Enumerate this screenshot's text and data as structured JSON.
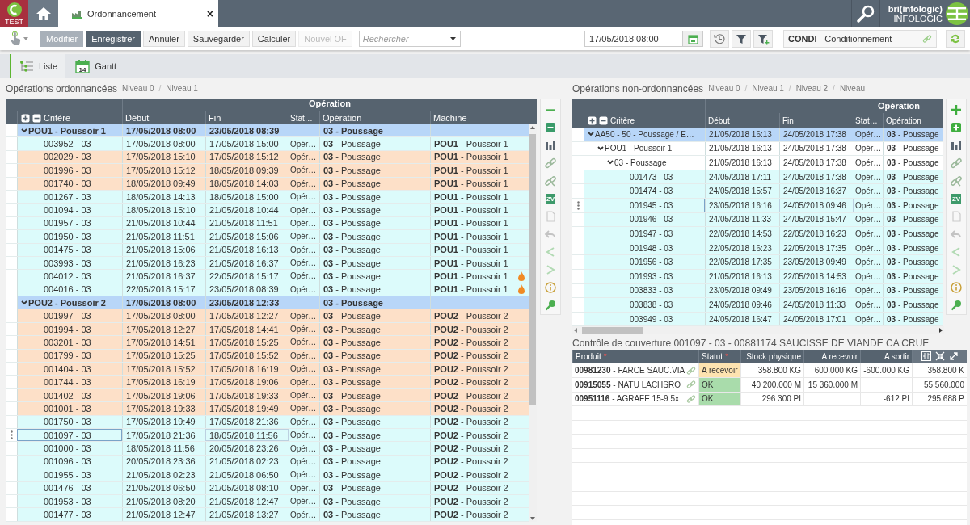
{
  "app": {
    "env_label": "TEST"
  },
  "tabs": [
    {
      "label": "Ordonnancement",
      "selected": true,
      "close": "×"
    }
  ],
  "user": {
    "name": "bri(infologic)",
    "company": "INFOLOGIC"
  },
  "toolbar": {
    "buttons": [
      {
        "label": "Modifier",
        "kind": "muted",
        "disabled": false
      },
      {
        "label": "Enregistrer",
        "kind": "primary",
        "disabled": false
      },
      {
        "label": "Annuler",
        "kind": "plain",
        "disabled": false
      },
      {
        "label": "Sauvegarder",
        "kind": "plain",
        "disabled": false
      },
      {
        "label": "Calculer",
        "kind": "plain",
        "disabled": false
      },
      {
        "label": "Nouvel OF",
        "kind": "plain",
        "disabled": true
      }
    ],
    "search": {
      "placeholder": "Rechercher"
    },
    "date": {
      "value": "17/05/2018 08:00"
    },
    "context": {
      "value": "**CONDI** - Conditionnement"
    }
  },
  "views": [
    {
      "label": "Liste",
      "kind": "list",
      "selected": true
    },
    {
      "label": "Gantt",
      "kind": "gantt",
      "selected": false,
      "icon_text": "14"
    }
  ],
  "left_panel": {
    "title": "Opérations ordonnancées",
    "breadcrumbs": [
      {
        "label": "Niveau 0",
        "separator": "/"
      },
      {
        "label": "Niveau 1"
      }
    ],
    "table": {
      "group_header": "Opération",
      "columns": [
        "Critère",
        "Début",
        "Fin",
        "Stat…",
        "Opération",
        "Machine"
      ],
      "rows": [
        {
          "kind": "group",
          "expanded": true,
          "selected": false,
          "color": "#b8d6f8",
          "criterion": "POU1 - Poussoir 1",
          "start": "17/05/2018 08:00",
          "end": "23/05/2018 08:39",
          "operation": "03 - Poussage",
          "children": [
            {
              "kind": "item",
              "selected": false,
              "alert": false,
              "color": "#dcfbfb",
              "criterion": "003952 - 03",
              "start": "17/05/2018 08:00",
              "end": "17/05/2018 15:00",
              "status": "Opér…",
              "operation": "**03** - Poussage",
              "machine": "**POU1** - Poussoir 1"
            },
            {
              "kind": "item",
              "selected": false,
              "alert": false,
              "color": "#fde0c8",
              "criterion": "002029 - 03",
              "start": "17/05/2018 15:10",
              "end": "17/05/2018 15:12",
              "status": "Opér…",
              "operation": "**03** - Poussage",
              "machine": "**POU1** - Poussoir 1"
            },
            {
              "kind": "item",
              "selected": false,
              "alert": false,
              "color": "#fde0c8",
              "criterion": "001996 - 03",
              "start": "17/05/2018 15:12",
              "end": "18/05/2018 09:39",
              "status": "Opér…",
              "operation": "**03** - Poussage",
              "machine": "**POU1** - Poussoir 1"
            },
            {
              "kind": "item",
              "selected": false,
              "alert": false,
              "color": "#fde0c8",
              "criterion": "001740 - 03",
              "start": "18/05/2018 09:49",
              "end": "18/05/2018 14:03",
              "status": "Opér…",
              "operation": "**03** - Poussage",
              "machine": "**POU1** - Poussoir 1"
            },
            {
              "kind": "item",
              "selected": false,
              "alert": false,
              "color": "#dcfbfb",
              "criterion": "001267 - 03",
              "start": "18/05/2018 14:13",
              "end": "18/05/2018 15:00",
              "status": "Opér…",
              "operation": "**03** - Poussage",
              "machine": "**POU1** - Poussoir 1"
            },
            {
              "kind": "item",
              "selected": false,
              "alert": false,
              "color": "#dcfbfb",
              "criterion": "001094 - 03",
              "start": "18/05/2018 15:10",
              "end": "21/05/2018 10:44",
              "status": "Opér…",
              "operation": "**03** - Poussage",
              "machine": "**POU1** - Poussoir 1"
            },
            {
              "kind": "item",
              "selected": false,
              "alert": false,
              "color": "#dcfbfb",
              "criterion": "001957 - 03",
              "start": "21/05/2018 10:44",
              "end": "21/05/2018 11:51",
              "status": "Opér…",
              "operation": "**03** - Poussage",
              "machine": "**POU1** - Poussoir 1"
            },
            {
              "kind": "item",
              "selected": false,
              "alert": false,
              "color": "#dcfbfb",
              "criterion": "001950 - 03",
              "start": "21/05/2018 11:51",
              "end": "21/05/2018 15:06",
              "status": "Opér…",
              "operation": "**03** - Poussage",
              "machine": "**POU1** - Poussoir 1"
            },
            {
              "kind": "item",
              "selected": false,
              "alert": false,
              "color": "#dcfbfb",
              "criterion": "001475 - 03",
              "start": "21/05/2018 15:06",
              "end": "21/05/2018 16:13",
              "status": "Opér…",
              "operation": "**03** - Poussage",
              "machine": "**POU1** - Poussoir 1"
            },
            {
              "kind": "item",
              "selected": false,
              "alert": false,
              "color": "#dcfbfb",
              "criterion": "003993 - 03",
              "start": "21/05/2018 16:23",
              "end": "21/05/2018 16:37",
              "status": "Opér…",
              "operation": "**03** - Poussage",
              "machine": "**POU1** - Poussoir 1"
            },
            {
              "kind": "item",
              "selected": false,
              "alert": true,
              "color": "#dcfbfb",
              "criterion": "004012 - 03",
              "start": "21/05/2018 16:37",
              "end": "22/05/2018 15:17",
              "status": "Opér…",
              "operation": "**03** - Poussage",
              "machine": "**POU1** - Poussoir 1"
            },
            {
              "kind": "item",
              "selected": false,
              "alert": true,
              "color": "#dcfbfb",
              "criterion": "004016 - 03",
              "start": "22/05/2018 15:17",
              "end": "23/05/2018 08:39",
              "status": "Opér…",
              "operation": "**03** - Poussage",
              "machine": "**POU1** - Poussoir 1"
            }
          ]
        },
        {
          "kind": "group",
          "expanded": true,
          "selected": false,
          "color": "#b8d6f8",
          "criterion": "POU2 - Poussoir 2",
          "start": "17/05/2018 08:00",
          "end": "23/05/2018 12:33",
          "operation": "03 - Poussage",
          "children": [
            {
              "kind": "item",
              "selected": false,
              "alert": false,
              "color": "#fde0c8",
              "criterion": "001997 - 03",
              "start": "17/05/2018 08:00",
              "end": "17/05/2018 12:27",
              "status": "Opér…",
              "operation": "**03** - Poussage",
              "machine": "**POU2** - Poussoir 2"
            },
            {
              "kind": "item",
              "selected": false,
              "alert": false,
              "color": "#fde0c8",
              "criterion": "001994 - 03",
              "start": "17/05/2018 12:27",
              "end": "17/05/2018 14:41",
              "status": "Opér…",
              "operation": "**03** - Poussage",
              "machine": "**POU2** - Poussoir 2"
            },
            {
              "kind": "item",
              "selected": false,
              "alert": false,
              "color": "#fde0c8",
              "criterion": "003201 - 03",
              "start": "17/05/2018 14:51",
              "end": "17/05/2018 15:25",
              "status": "Opér…",
              "operation": "**03** - Poussage",
              "machine": "**POU2** - Poussoir 2"
            },
            {
              "kind": "item",
              "selected": false,
              "alert": false,
              "color": "#fde0c8",
              "criterion": "001799 - 03",
              "start": "17/05/2018 15:25",
              "end": "17/05/2018 15:52",
              "status": "Opér…",
              "operation": "**03** - Poussage",
              "machine": "**POU2** - Poussoir 2"
            },
            {
              "kind": "item",
              "selected": false,
              "alert": false,
              "color": "#fde0c8",
              "criterion": "001404 - 03",
              "start": "17/05/2018 15:52",
              "end": "17/05/2018 16:19",
              "status": "Opér…",
              "operation": "**03** - Poussage",
              "machine": "**POU2** - Poussoir 2"
            },
            {
              "kind": "item",
              "selected": false,
              "alert": false,
              "color": "#fde0c8",
              "criterion": "001744 - 03",
              "start": "17/05/2018 16:19",
              "end": "17/05/2018 19:06",
              "status": "Opér…",
              "operation": "**03** - Poussage",
              "machine": "**POU2** - Poussoir 2"
            },
            {
              "kind": "item",
              "selected": false,
              "alert": false,
              "color": "#fde0c8",
              "criterion": "001402 - 03",
              "start": "17/05/2018 19:06",
              "end": "17/05/2018 19:33",
              "status": "Opér…",
              "operation": "**03** - Poussage",
              "machine": "**POU2** - Poussoir 2"
            },
            {
              "kind": "item",
              "selected": false,
              "alert": false,
              "color": "#fde0c8",
              "criterion": "001001 - 03",
              "start": "17/05/2018 19:33",
              "end": "17/05/2018 19:49",
              "status": "Opér…",
              "operation": "**03** - Poussage",
              "machine": "**POU2** - Poussoir 2"
            },
            {
              "kind": "item",
              "selected": false,
              "alert": false,
              "color": "#dcfbfb",
              "criterion": "001750 - 03",
              "start": "17/05/2018 19:49",
              "end": "17/05/2018 21:36",
              "status": "Opér…",
              "operation": "**03** - Poussage",
              "machine": "**POU2** - Poussoir 2"
            },
            {
              "kind": "item",
              "selected": true,
              "alert": false,
              "color": "#dcfbfb",
              "criterion": "001097 - 03",
              "start": "17/05/2018 21:36",
              "end": "18/05/2018 11:56",
              "status": "Opér…",
              "operation": "**03** - Poussage",
              "machine": "**POU2** - Poussoir 2"
            },
            {
              "kind": "item",
              "selected": false,
              "alert": false,
              "color": "#dcfbfb",
              "criterion": "001000 - 03",
              "start": "18/05/2018 11:56",
              "end": "20/05/2018 23:26",
              "status": "Opér…",
              "operation": "**03** - Poussage",
              "machine": "**POU2** - Poussoir 2"
            },
            {
              "kind": "item",
              "selected": false,
              "alert": false,
              "color": "#dcfbfb",
              "criterion": "001096 - 03",
              "start": "20/05/2018 23:36",
              "end": "21/05/2018 02:23",
              "status": "Opér…",
              "operation": "**03** - Poussage",
              "machine": "**POU2** - Poussoir 2"
            },
            {
              "kind": "item",
              "selected": false,
              "alert": false,
              "color": "#dcfbfb",
              "criterion": "001955 - 03",
              "start": "21/05/2018 02:23",
              "end": "21/05/2018 06:50",
              "status": "Opér…",
              "operation": "**03** - Poussage",
              "machine": "**POU2** - Poussoir 2"
            },
            {
              "kind": "item",
              "selected": false,
              "alert": false,
              "color": "#dcfbfb",
              "criterion": "001476 - 03",
              "start": "21/05/2018 06:50",
              "end": "21/05/2018 08:10",
              "status": "Opér…",
              "operation": "**03** - Poussage",
              "machine": "**POU2** - Poussoir 2"
            },
            {
              "kind": "item",
              "selected": false,
              "alert": false,
              "color": "#dcfbfb",
              "criterion": "001953 - 03",
              "start": "21/05/2018 08:20",
              "end": "21/05/2018 12:47",
              "status": "Opér…",
              "operation": "**03** - Poussage",
              "machine": "**POU2** - Poussoir 2"
            },
            {
              "kind": "item",
              "selected": false,
              "alert": false,
              "color": "#dcfbfb",
              "criterion": "001477 - 03",
              "start": "21/05/2018 12:47",
              "end": "21/05/2018 13:27",
              "status": "Opér…",
              "operation": "**03** - Poussage",
              "machine": "**POU2** - Poussoir 2"
            }
          ]
        }
      ]
    },
    "tools": [
      {
        "kind": "collapse",
        "disabled": false
      },
      {
        "kind": "panel",
        "disabled": false
      },
      {
        "kind": "chart",
        "disabled": false
      },
      {
        "kind": "link",
        "disabled": false
      },
      {
        "kind": "unlink",
        "disabled": false
      },
      {
        "kind": "zv",
        "label": "ZV",
        "disabled": false
      },
      {
        "kind": "document",
        "disabled": true
      },
      {
        "kind": "undo",
        "disabled": true
      },
      {
        "kind": "prev",
        "disabled": true
      },
      {
        "kind": "next",
        "disabled": true
      },
      {
        "kind": "info",
        "disabled": false
      },
      {
        "kind": "zoom",
        "disabled": false
      }
    ]
  },
  "right_panel": {
    "title": "Opérations non-ordonnancées",
    "breadcrumbs": [
      {
        "label": "Niveau 0",
        "separator": "/"
      },
      {
        "label": "Niveau 1",
        "separator": "/"
      },
      {
        "label": "Niveau 2",
        "separator": "/"
      },
      {
        "label": "Niveau"
      }
    ],
    "table": {
      "group_header": "Opération",
      "columns": [
        "Critère",
        "Début",
        "Fin",
        "Stat…",
        "Opération"
      ],
      "rows": [
        {
          "kind": "node",
          "expanded": true,
          "selected": false,
          "color": "#b8d6f8",
          "criterion": "AA50 - 50 - Poussage / E…",
          "start": "21/05/2018 16:13",
          "end": "24/05/2018 17:38",
          "status": "Opér…",
          "operation": "**03** - Poussage",
          "children": [
            {
              "kind": "node",
              "expanded": true,
              "selected": false,
              "color": "#ffffff",
              "criterion": "POU1 - Poussoir 1",
              "start": "21/05/2018 16:13",
              "end": "24/05/2018 17:38",
              "status": "Opér…",
              "operation": "**03** - Poussage",
              "children": [
                {
                  "kind": "node",
                  "expanded": true,
                  "selected": false,
                  "color": "#ffffff",
                  "criterion": "03 - Poussage",
                  "start": "21/05/2018 16:13",
                  "end": "24/05/2018 17:38",
                  "status": "Opér…",
                  "operation": "**03** - Poussage",
                  "children": [
                    {
                      "kind": "item",
                      "selected": false,
                      "color": "#dcfbfb",
                      "criterion": "001473 - 03",
                      "start": "24/05/2018 17:11",
                      "end": "24/05/2018 17:38",
                      "status": "Opér…",
                      "operation": "**03** - Poussage"
                    },
                    {
                      "kind": "item",
                      "selected": false,
                      "color": "#dcfbfb",
                      "criterion": "001474 - 03",
                      "start": "24/05/2018 15:57",
                      "end": "24/05/2018 16:37",
                      "status": "Opér…",
                      "operation": "**03** - Poussage"
                    },
                    {
                      "kind": "item",
                      "selected": true,
                      "color": "#dcfbfb",
                      "criterion": "001945 - 03",
                      "start": "23/05/2018 16:16",
                      "end": "24/05/2018 09:46",
                      "status": "Opér…",
                      "operation": "**03** - Poussage"
                    },
                    {
                      "kind": "item",
                      "selected": false,
                      "color": "#dcfbfb",
                      "criterion": "001946 - 03",
                      "start": "24/05/2018 11:33",
                      "end": "24/05/2018 15:47",
                      "status": "Opér…",
                      "operation": "**03** - Poussage"
                    },
                    {
                      "kind": "item",
                      "selected": false,
                      "color": "#dcfbfb",
                      "criterion": "001947 - 03",
                      "start": "22/05/2018 14:53",
                      "end": "22/05/2018 16:23",
                      "status": "Opér…",
                      "operation": "**03** - Poussage"
                    },
                    {
                      "kind": "item",
                      "selected": false,
                      "color": "#dcfbfb",
                      "criterion": "001948 - 03",
                      "start": "22/05/2018 16:23",
                      "end": "22/05/2018 17:35",
                      "status": "Opér…",
                      "operation": "**03** - Poussage"
                    },
                    {
                      "kind": "item",
                      "selected": false,
                      "color": "#dcfbfb",
                      "criterion": "001956 - 03",
                      "start": "22/05/2018 17:35",
                      "end": "23/05/2018 09:49",
                      "status": "Opér…",
                      "operation": "**03** - Poussage"
                    },
                    {
                      "kind": "item",
                      "selected": false,
                      "color": "#dcfbfb",
                      "criterion": "001993 - 03",
                      "start": "21/05/2018 16:13",
                      "end": "22/05/2018 14:53",
                      "status": "Opér…",
                      "operation": "**03** - Poussage"
                    },
                    {
                      "kind": "item",
                      "selected": false,
                      "color": "#dcfbfb",
                      "criterion": "003833 - 03",
                      "start": "23/05/2018 09:49",
                      "end": "23/05/2018 16:16",
                      "status": "Opér…",
                      "operation": "**03** - Poussage"
                    },
                    {
                      "kind": "item",
                      "selected": false,
                      "color": "#dcfbfb",
                      "criterion": "003838 - 03",
                      "start": "24/05/2018 09:46",
                      "end": "24/05/2018 11:33",
                      "status": "Opér…",
                      "operation": "**03** - Poussage"
                    },
                    {
                      "kind": "item",
                      "selected": false,
                      "color": "#dcfbfb",
                      "criterion": "003949 - 03",
                      "start": "24/05/2018 16:47",
                      "end": "24/05/2018 17:01",
                      "status": "Opér…",
                      "operation": "**03** - Poussage"
                    }
                  ]
                }
              ]
            }
          ]
        }
      ]
    },
    "tools": [
      {
        "kind": "add",
        "disabled": false
      },
      {
        "kind": "add-panel",
        "disabled": false
      },
      {
        "kind": "chart",
        "disabled": false
      },
      {
        "kind": "link",
        "disabled": false
      },
      {
        "kind": "unlink",
        "disabled": false
      },
      {
        "kind": "zv",
        "label": "ZV",
        "disabled": false
      },
      {
        "kind": "document",
        "disabled": true
      },
      {
        "kind": "undo",
        "disabled": true
      },
      {
        "kind": "prev",
        "disabled": true
      },
      {
        "kind": "next",
        "disabled": true
      },
      {
        "kind": "info",
        "disabled": false
      },
      {
        "kind": "zoom",
        "disabled": false
      }
    ]
  },
  "coverage": {
    "title": "Contrôle de couverture 001097 - 03 - 00881174 SAUCISSE DE VIANDE CA CRUE",
    "columns": [
      {
        "label": "Produit",
        "mark": "*"
      },
      {
        "label": "Statut",
        "mark": "*"
      },
      {
        "label": "Stock physique"
      },
      {
        "label": "A recevoir"
      },
      {
        "label": "A sortir"
      }
    ],
    "rows": [
      {
        "product": "**00981230** - FARCE SAUC.VIA",
        "linked": true,
        "status": "A recevoir",
        "color": "#fde3b0",
        "stock": "358.800 KG",
        "incoming": "600.000 KG",
        "outgoing": "-600.000 KG",
        "column_6": "358.800 K"
      },
      {
        "product": "**00915055** - NATU LACHSRO",
        "linked": true,
        "status": "OK",
        "color": "#a9dcab",
        "stock": "40 200.000 M",
        "incoming": "15 360.000 M",
        "column_6": "55 560.000"
      },
      {
        "product": "**00951116** - AGRAFE 15-9 5x",
        "linked": true,
        "status": "OK",
        "color": "#a9dcab",
        "stock": "296 300 PI",
        "outgoing": "-612 PI",
        "column_6": "295 688 P"
      }
    ]
  }
}
